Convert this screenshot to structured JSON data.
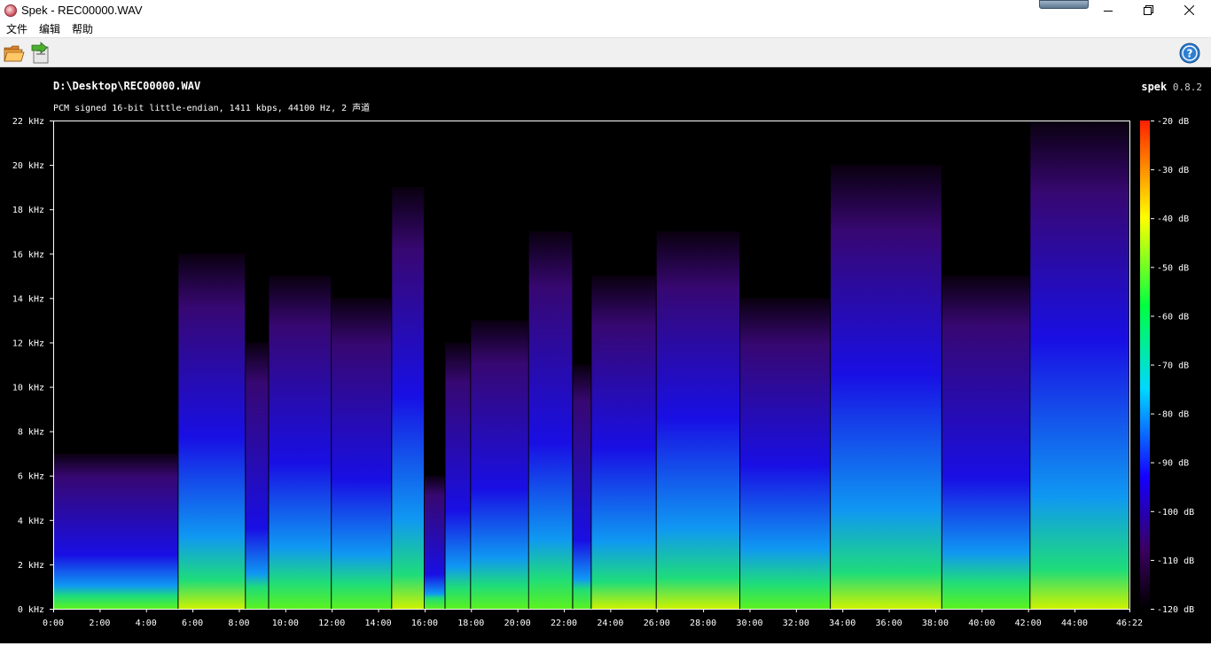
{
  "window": {
    "title": "Spek - REC00000.WAV",
    "minimize_icon": "minimize-icon",
    "maximize_icon": "restore-icon",
    "close_icon": "close-icon"
  },
  "menu": {
    "items": [
      {
        "label": "文件"
      },
      {
        "label": "编辑"
      },
      {
        "label": "帮助"
      }
    ]
  },
  "toolbar": {
    "open_icon": "folder-open-icon",
    "save_icon": "save-export-icon",
    "help_icon": "help-icon"
  },
  "spek": {
    "file_path": "D:\\Desktop\\REC00000.WAV",
    "file_info": "PCM signed 16-bit little-endian, 1411 kbps, 44100 Hz, 2 声道",
    "brand_name": "spek",
    "brand_version": "0.8.2"
  },
  "chart_data": {
    "type": "heatmap",
    "title": "",
    "xlabel": "",
    "ylabel": "",
    "x_unit": "time (mm:ss)",
    "x_range": [
      "0:00",
      "46:22"
    ],
    "x_ticks": [
      "0:00",
      "2:00",
      "4:00",
      "6:00",
      "8:00",
      "10:00",
      "12:00",
      "14:00",
      "16:00",
      "18:00",
      "20:00",
      "22:00",
      "24:00",
      "26:00",
      "28:00",
      "30:00",
      "32:00",
      "34:00",
      "36:00",
      "38:00",
      "40:00",
      "42:00",
      "44:00",
      "46:22"
    ],
    "y_range_khz": [
      0,
      22
    ],
    "y_ticks": [
      "0 kHz",
      "2 kHz",
      "4 kHz",
      "6 kHz",
      "8 kHz",
      "10 kHz",
      "12 kHz",
      "14 kHz",
      "16 kHz",
      "18 kHz",
      "20 kHz",
      "22 kHz"
    ],
    "colorbar_range_db": [
      -120,
      -20
    ],
    "colorbar_ticks": [
      "-20 dB",
      "-30 dB",
      "-40 dB",
      "-50 dB",
      "-60 dB",
      "-70 dB",
      "-80 dB",
      "-90 dB",
      "-100 dB",
      "-110 dB",
      "-120 dB"
    ],
    "colormap": [
      "#000000",
      "#3a0060",
      "#1400ff",
      "#00d8ff",
      "#00ff40",
      "#ffff00",
      "#ff2000"
    ],
    "segments": [
      {
        "start_min": 0.0,
        "end_min": 5.4,
        "peak_khz": 7,
        "level": 0.55
      },
      {
        "start_min": 5.4,
        "end_min": 8.3,
        "peak_khz": 16,
        "level": 0.85
      },
      {
        "start_min": 8.3,
        "end_min": 9.3,
        "peak_khz": 12,
        "level": 0.45
      },
      {
        "start_min": 9.3,
        "end_min": 12.0,
        "peak_khz": 15,
        "level": 0.75
      },
      {
        "start_min": 12.0,
        "end_min": 14.6,
        "peak_khz": 14,
        "level": 0.7
      },
      {
        "start_min": 14.6,
        "end_min": 16.0,
        "peak_khz": 19,
        "level": 0.9
      },
      {
        "start_min": 16.0,
        "end_min": 16.9,
        "peak_khz": 6,
        "level": 0.35
      },
      {
        "start_min": 16.9,
        "end_min": 18.0,
        "peak_khz": 12,
        "level": 0.6
      },
      {
        "start_min": 18.0,
        "end_min": 20.5,
        "peak_khz": 13,
        "level": 0.7
      },
      {
        "start_min": 20.5,
        "end_min": 22.4,
        "peak_khz": 17,
        "level": 0.75
      },
      {
        "start_min": 22.4,
        "end_min": 23.2,
        "peak_khz": 11,
        "level": 0.4
      },
      {
        "start_min": 23.2,
        "end_min": 26.0,
        "peak_khz": 15,
        "level": 0.85
      },
      {
        "start_min": 26.0,
        "end_min": 29.6,
        "peak_khz": 17,
        "level": 0.9
      },
      {
        "start_min": 29.6,
        "end_min": 33.5,
        "peak_khz": 14,
        "level": 0.8
      },
      {
        "start_min": 33.5,
        "end_min": 38.3,
        "peak_khz": 20,
        "level": 0.95
      },
      {
        "start_min": 38.3,
        "end_min": 42.1,
        "peak_khz": 15,
        "level": 0.65
      },
      {
        "start_min": 42.1,
        "end_min": 46.37,
        "peak_khz": 22,
        "level": 1.0
      }
    ]
  }
}
